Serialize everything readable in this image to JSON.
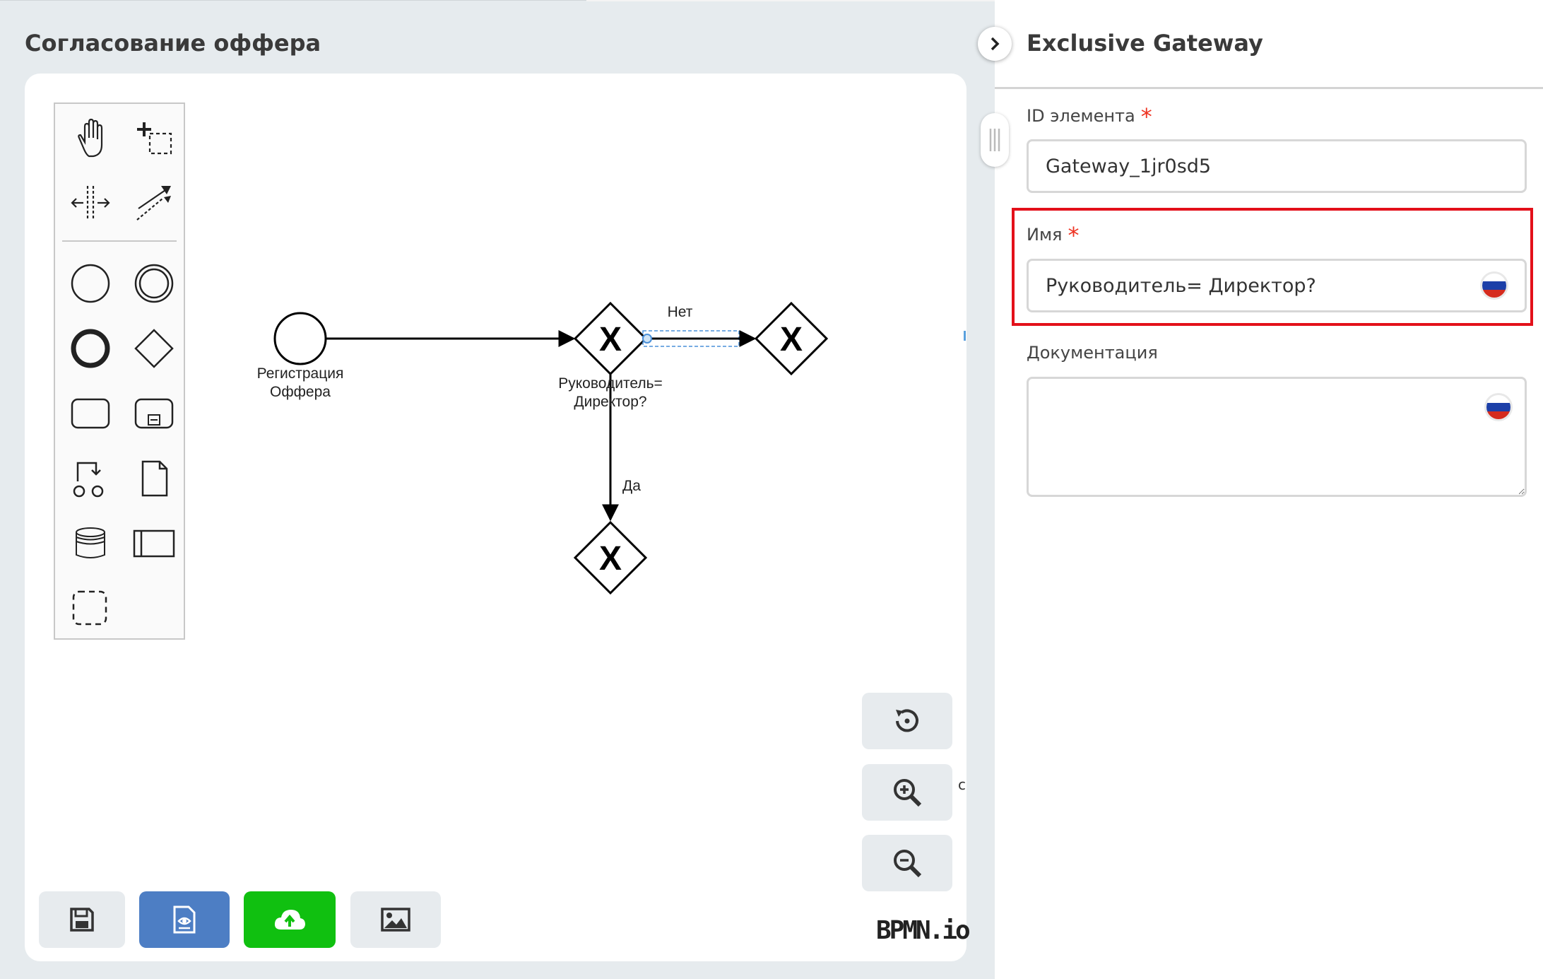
{
  "page": {
    "title": "Согласование оффера"
  },
  "diagram": {
    "start_event_label": "Регистрация Оффера",
    "gateway_main_label": "Руководитель= Директор?",
    "flow_no_label": "Нет",
    "flow_yes_label": "Да",
    "gateway_symbol": "X",
    "watermark": "BPMN.io",
    "stray_char": "с"
  },
  "palette": {
    "tools": [
      "hand-tool",
      "lasso-tool",
      "space-tool",
      "global-connect-tool",
      "create-start-event",
      "create-intermediate-event",
      "create-end-event",
      "create-gateway",
      "create-task",
      "create-subprocess",
      "create-data-object-reference",
      "create-data-object",
      "create-data-store",
      "create-pool",
      "create-group"
    ]
  },
  "controls": {
    "reset": "reset-zoom-icon",
    "zoom_in": "zoom-in-icon",
    "zoom_out": "zoom-out-icon"
  },
  "bottom_buttons": [
    {
      "icon": "save-icon",
      "color": "#e7ebee"
    },
    {
      "icon": "preview-xml-icon",
      "color": "#4d7ec4"
    },
    {
      "icon": "deploy-upload-icon",
      "color": "#10c010"
    },
    {
      "icon": "export-image-icon",
      "color": "#e7ebee"
    }
  ],
  "panel": {
    "title": "Exclusive Gateway",
    "id_label": "ID элемента",
    "id_value": "Gateway_1jr0sd5",
    "name_label": "Имя",
    "name_value": "Руководитель= Директор?",
    "doc_label": "Документация",
    "doc_value": "",
    "required_mark": "*",
    "language_flag": "russia-flag-icon"
  },
  "colors": {
    "highlight": "#e3101a",
    "required": "#ee3322",
    "selection": "#4a90d9"
  }
}
